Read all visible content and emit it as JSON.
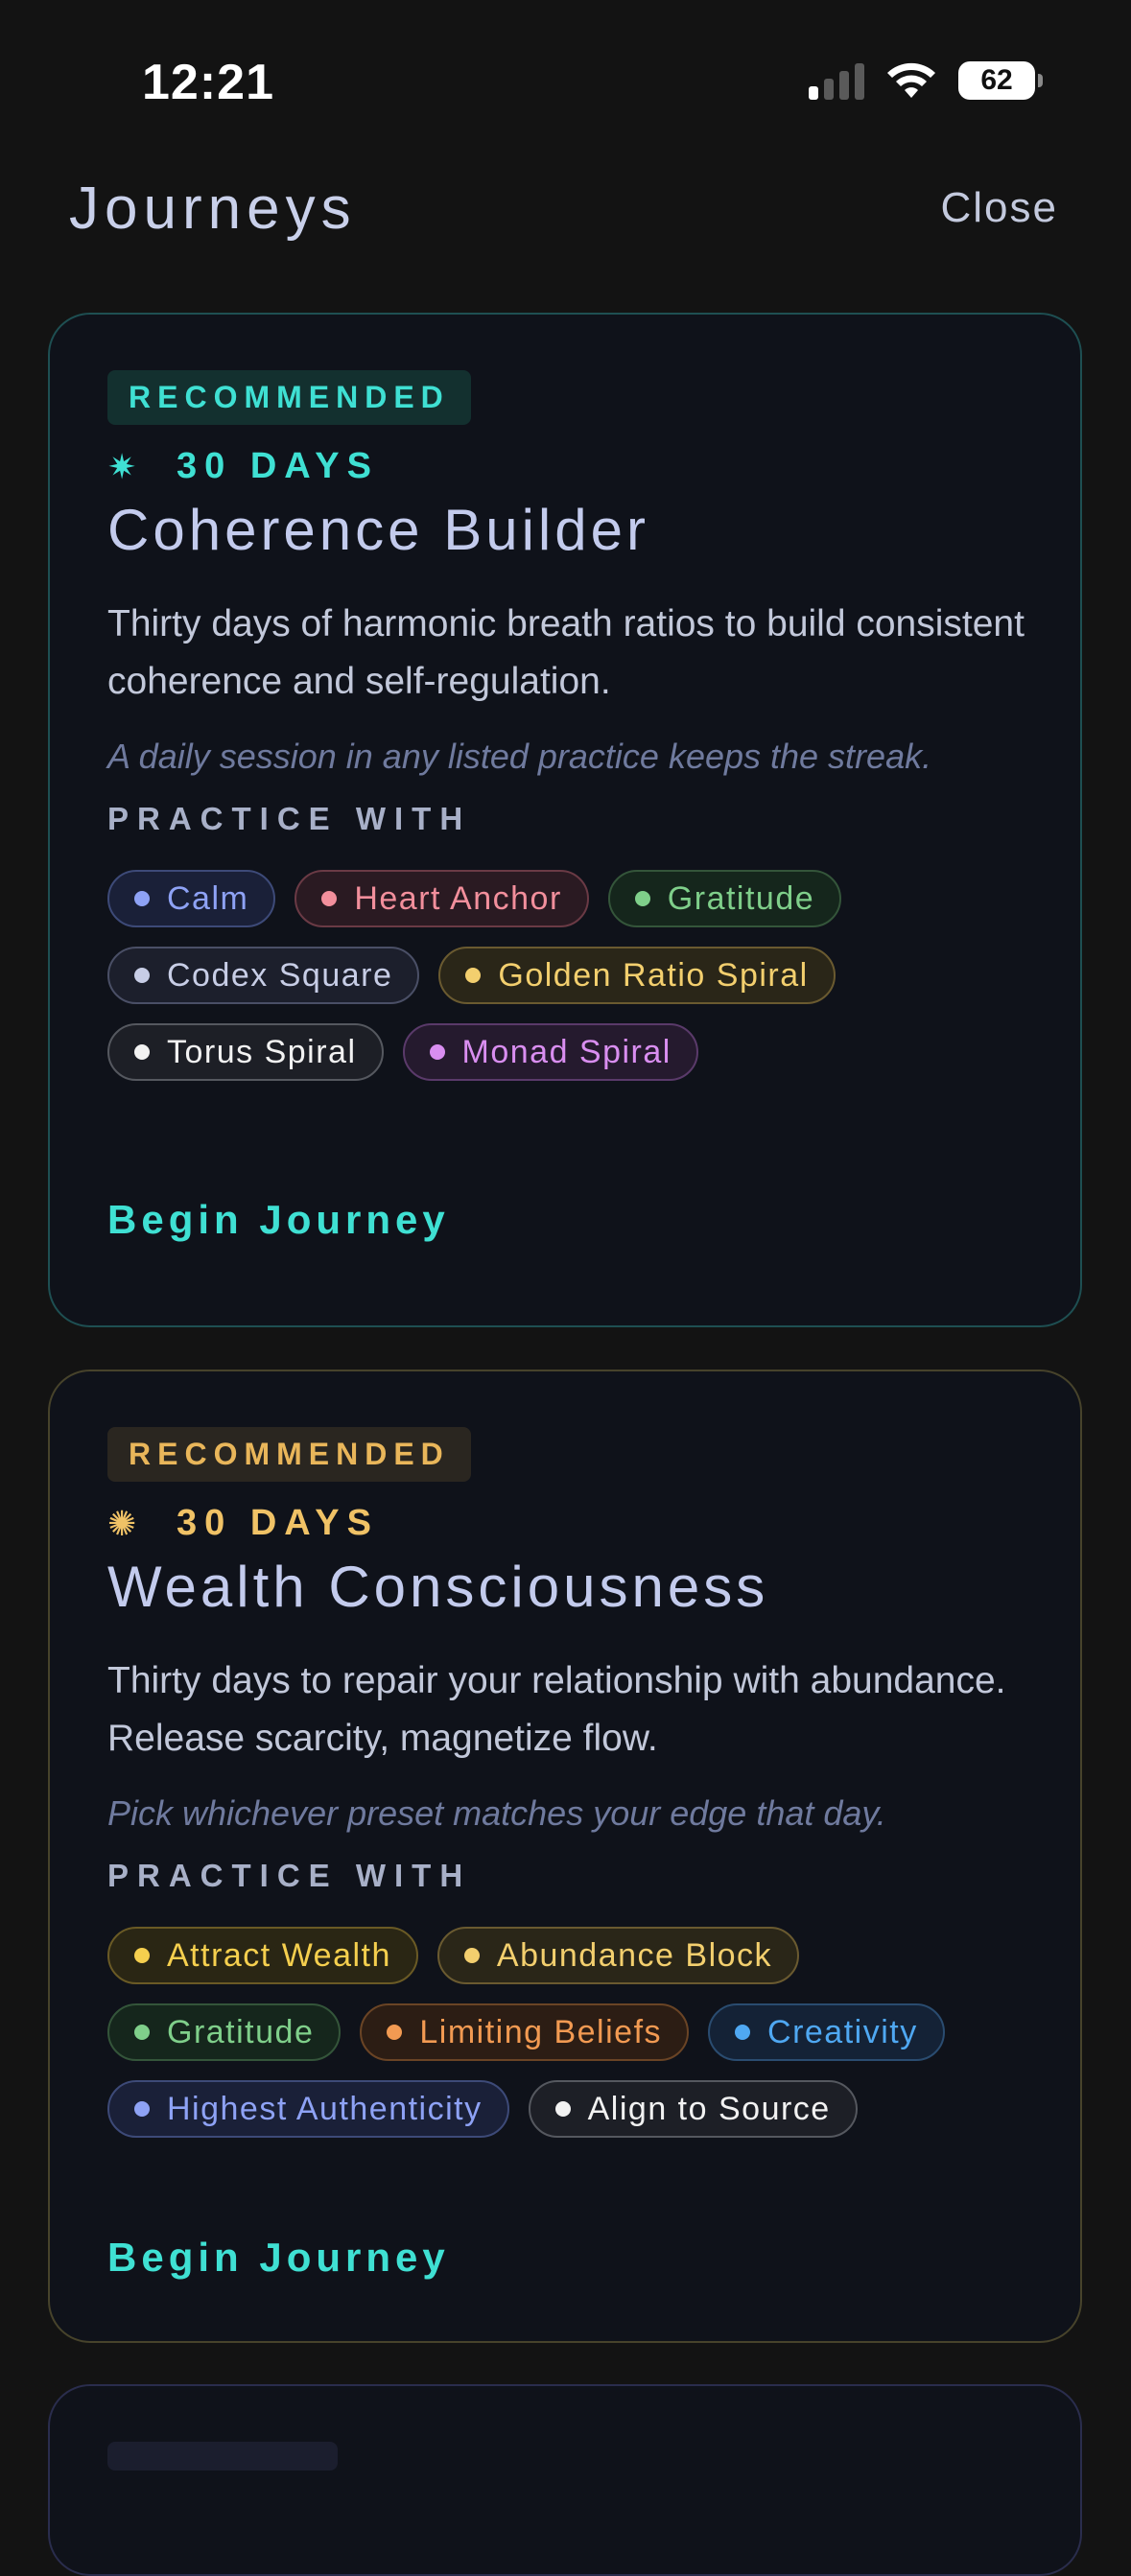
{
  "status_bar": {
    "time": "12:21",
    "battery": "62",
    "signal_icon": "signal-icon",
    "wifi_icon": "wifi-icon"
  },
  "header": {
    "title": "Journeys",
    "close_label": "Close"
  },
  "journeys": [
    {
      "badge": "RECOMMENDED",
      "symbol": "✷",
      "days": "30 DAYS",
      "title": "Coherence Builder",
      "description": "Thirty days of harmonic breath ratios to build consistent coherence and self-regulation.",
      "note": "A daily session in any listed practice keeps the streak.",
      "practice_label": "PRACTICE WITH",
      "practices": [
        {
          "label": "Calm",
          "color": "#8ea2f5",
          "bg": "#1a2038",
          "border": "#3d4a78"
        },
        {
          "label": "Heart Anchor",
          "color": "#f28f9c",
          "bg": "#2a1a22",
          "border": "#6a3a45"
        },
        {
          "label": "Gratitude",
          "color": "#7fcf8a",
          "bg": "#15261c",
          "border": "#34553a"
        },
        {
          "label": "Codex Square",
          "color": "#c7cde6",
          "bg": "#1c1f2c",
          "border": "#4a4f66"
        },
        {
          "label": "Golden Ratio Spiral",
          "color": "#f3cf6e",
          "bg": "#2a2618",
          "border": "#6a5a30"
        },
        {
          "label": "Torus Spiral",
          "color": "#f2f2f2",
          "bg": "#1d1f26",
          "border": "#55585f"
        },
        {
          "label": "Monad Spiral",
          "color": "#d98ef0",
          "bg": "#251a2e",
          "border": "#5a3a6a"
        }
      ],
      "cta": "Begin Journey"
    },
    {
      "badge": "RECOMMENDED",
      "symbol": "✺",
      "days": "30 DAYS",
      "title": "Wealth Consciousness",
      "description": "Thirty days to repair your relationship with abundance. Release scarcity, magnetize flow.",
      "note": "Pick whichever preset matches your edge that day.",
      "practice_label": "PRACTICE WITH",
      "practices": [
        {
          "label": "Attract Wealth",
          "color": "#f5cf4e",
          "bg": "#2a2614",
          "border": "#6a5a25"
        },
        {
          "label": "Abundance Block",
          "color": "#f3cf6e",
          "bg": "#2a2618",
          "border": "#6a5a30"
        },
        {
          "label": "Gratitude",
          "color": "#7fcf8a",
          "bg": "#15261c",
          "border": "#34553a"
        },
        {
          "label": "Limiting Beliefs",
          "color": "#f29a52",
          "bg": "#2c1d14",
          "border": "#6a4425"
        },
        {
          "label": "Creativity",
          "color": "#4fa8f2",
          "bg": "#142236",
          "border": "#2a4c70"
        },
        {
          "label": "Highest Authenticity",
          "color": "#8ea2f5",
          "bg": "#1a2038",
          "border": "#3d4a78"
        },
        {
          "label": "Align to Source",
          "color": "#f2f2f2",
          "bg": "#1d1f26",
          "border": "#55585f"
        }
      ],
      "cta": "Begin Journey"
    }
  ]
}
